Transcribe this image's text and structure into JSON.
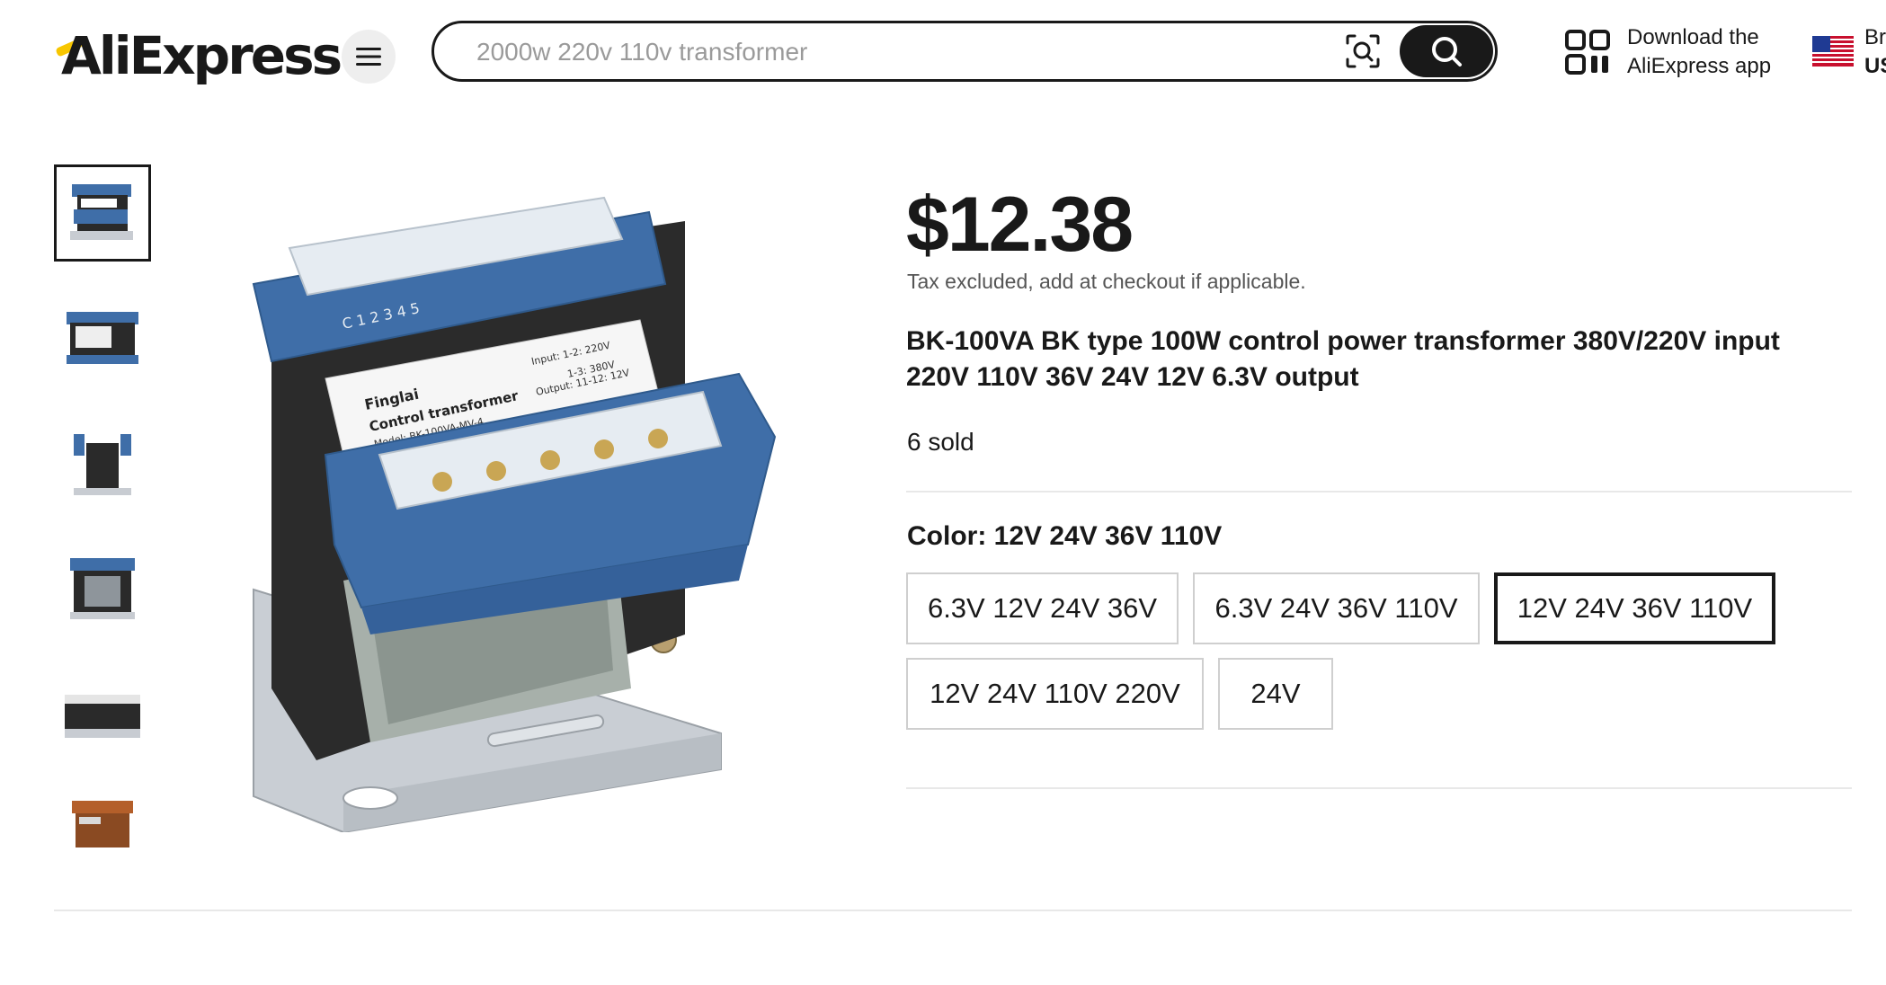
{
  "header": {
    "logo_text": "AliExpress",
    "menu_icon": "hamburger-icon",
    "search": {
      "placeholder": "2000w 220v 110v transformer",
      "value": "",
      "image_search_icon": "camera-scan-icon",
      "submit_icon": "search-icon"
    },
    "download_app": {
      "line1": "Download the",
      "line2": "AliExpress app",
      "icon": "qr-code-icon"
    },
    "locale": {
      "flag_icon": "us-flag-icon",
      "line1": "Br",
      "line2": "US"
    }
  },
  "gallery": {
    "thumbnails": [
      {
        "name": "transformer front angle",
        "active": true
      },
      {
        "name": "transformer front label",
        "active": false
      },
      {
        "name": "transformer side",
        "active": false
      },
      {
        "name": "transformer front core",
        "active": false
      },
      {
        "name": "transformer top",
        "active": false
      },
      {
        "name": "transformer orange variant",
        "active": false
      }
    ],
    "main_image": {
      "brand": "Finglai",
      "label_title": "Control transformer",
      "model": "Model: BK-100VA-MV-4",
      "input": "Input: 1-2: 220V",
      "input2": "1-3: 380V",
      "output": "Output: 11-12: 12V",
      "terminals_top": [
        "5",
        "4",
        "3",
        "2",
        "1",
        "C"
      ]
    }
  },
  "product": {
    "price": "$12.38",
    "tax_note": "Tax excluded, add at checkout if applicable.",
    "title_line1": "BK-100VA BK type 100W control power transformer 380V/220V input",
    "title_line2": "220V 110V 36V 24V 12V 6.3V output",
    "sold": "6 sold",
    "color_label": "Color: 12V 24V 36V 110V",
    "options": [
      {
        "label": "6.3V 12V 24V 36V",
        "selected": false
      },
      {
        "label": "6.3V 24V 36V 110V",
        "selected": false
      },
      {
        "label": "12V 24V 36V 110V",
        "selected": true
      },
      {
        "label": "12V 24V 110V 220V",
        "selected": false
      },
      {
        "label": "24V",
        "selected": false
      }
    ]
  },
  "colors": {
    "text": "#191919",
    "logo_accent": "#f7c600",
    "transformer_blue": "#3f6ea8",
    "divider": "#e8e8e8"
  }
}
